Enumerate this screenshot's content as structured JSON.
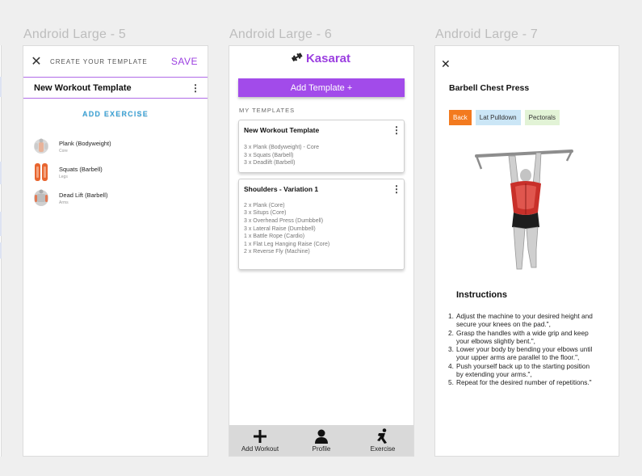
{
  "frames": {
    "f5_label": "Android Large - 5",
    "f6_label": "Android Large - 6",
    "f7_label": "Android Large - 7"
  },
  "create": {
    "close_icon": "close-icon",
    "title": "CREATE YOUR TEMPLATE",
    "save_label": "SAVE",
    "template_name": "New Workout Template",
    "add_exercise_label": "ADD EXERCISE",
    "exercises": [
      {
        "name": "Plank (Bodyweight)",
        "category": "Core"
      },
      {
        "name": "Squats (Barbell)",
        "category": "Legs"
      },
      {
        "name": "Dead Lift (Barbell)",
        "category": "Arms"
      }
    ]
  },
  "templates": {
    "logo_text": "Kasarat",
    "logo_icon": "dumbbell-icon",
    "add_button_label": "Add Template +",
    "section_label": "MY TEMPLATES",
    "accent_color": "#a24bea",
    "cards": [
      {
        "title": "New Workout Template",
        "lines": [
          "3 x Plank (Bodyweight) - Core",
          "3 x Squats (Barbell)",
          "3 x Deadlift (Barbell)"
        ]
      },
      {
        "title": "Shoulders - Variation 1",
        "lines": [
          "2 x Plank (Core)",
          "3 x Situps (Core)",
          "3 x Overhead Press (Dumbbell)",
          "3 x Lateral Raise (Dumbbell)",
          "1 x Battle Rope (Cardio)",
          "1 x Flat Leg Hanging Raise (Core)",
          "2 x Reverse Fly (Machine)"
        ]
      }
    ],
    "nav": [
      {
        "label": "Add Workout",
        "icon": "plus-icon"
      },
      {
        "label": "Profile",
        "icon": "person-icon"
      },
      {
        "label": "Exercise",
        "icon": "exercise-icon"
      }
    ]
  },
  "detail": {
    "title": "Barbell Chest Press",
    "tags": [
      "Back",
      "Lat Pulldown",
      "Pectorals"
    ],
    "tag_colors": [
      "#f37a1f",
      "#cbe6f6",
      "#e2f3d6"
    ],
    "instructions_title": "Instructions",
    "instructions": [
      "Adjust the machine to your desired height and secure your knees on the pad.\",",
      "Grasp the handles with a wide grip and keep your elbows slightly bent.\",",
      "Lower your body by bending your elbows until your upper arms are parallel to the floor.\",",
      "Push yourself back up to the starting position by extending your arms.\",",
      "Repeat for the desired number of repetitions.\""
    ]
  }
}
